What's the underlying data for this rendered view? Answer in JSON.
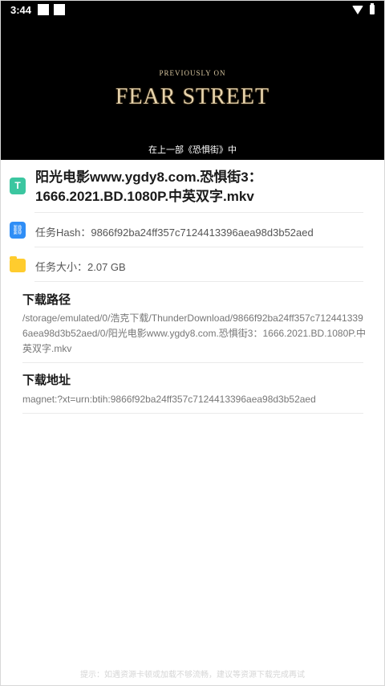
{
  "status_bar": {
    "time": "3:44"
  },
  "video": {
    "subtitle_top": "PREVIOUSLY ON",
    "title": "FEAR STREET",
    "caption": "在上一部《恐惧街》中"
  },
  "task": {
    "file_name": "阳光电影www.ygdy8.com.恐惧街3：1666.2021.BD.1080P.中英双字.mkv",
    "hash_text": "任务Hash：9866f92ba24ff357c7124413396aea98d3b52aed",
    "size_text": "任务大小：2.07 GB",
    "file_icon_glyph": "T",
    "link_icon_glyph": "⛓"
  },
  "download_path": {
    "label": "下载路径",
    "value": "/storage/emulated/0/浩克下载/ThunderDownload/9866f92ba24ff357c7124413396aea98d3b52aed/0/阳光电影www.ygdy8.com.恐惧街3：1666.2021.BD.1080P.中英双字.mkv"
  },
  "download_address": {
    "label": "下载地址",
    "value": "magnet:?xt=urn:btih:9866f92ba24ff357c7124413396aea98d3b52aed"
  },
  "footer": {
    "hint": "提示：如遇资源卡顿或加载不够流畅，建议等资源下载完成再试"
  },
  "colors": {
    "file_icon": "#3bc6a0",
    "link_icon": "#2f8ef6",
    "folder_icon": "#ffcc2e"
  }
}
